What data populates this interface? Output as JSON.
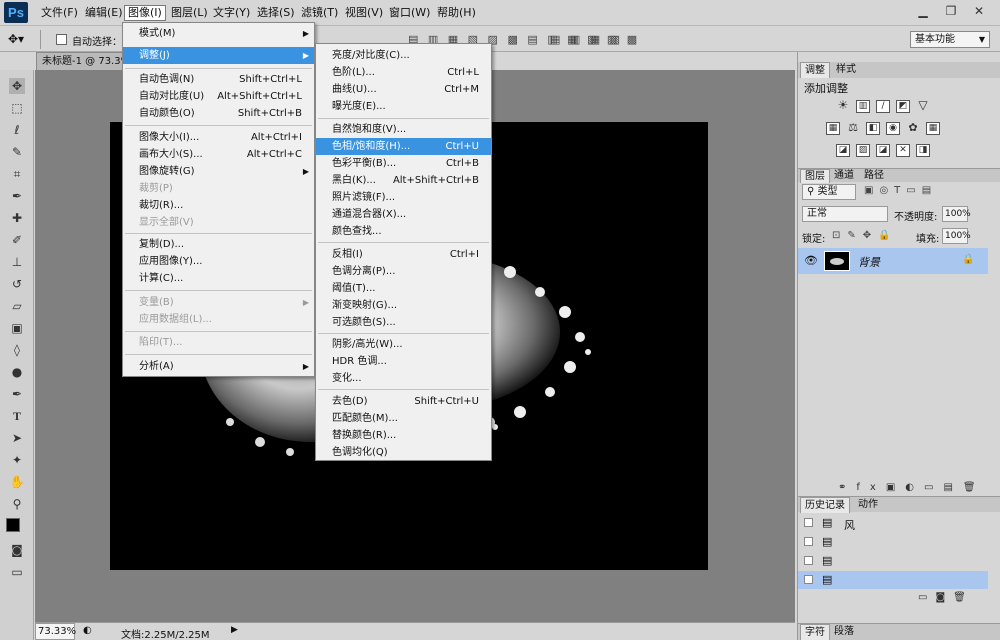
{
  "app": {
    "logo": "Ps"
  },
  "menubar": {
    "items": [
      "文件(F)",
      "编辑(E)",
      "图像(I)",
      "图层(L)",
      "文字(Y)",
      "选择(S)",
      "滤镜(T)",
      "视图(V)",
      "窗口(W)",
      "帮助(H)"
    ],
    "active": "图像(I)"
  },
  "window_controls": [
    "▁",
    "❐",
    "✕"
  ],
  "options": {
    "auto_select": "自动选择：",
    "workspace": "基本功能"
  },
  "document": {
    "tab_title": "未标题-1 @ 73.3%",
    "zoom": "73.33%",
    "doc_info": "文档:2.25M/2.25M"
  },
  "image_menu": {
    "items": [
      {
        "label": "模式(M)",
        "shortcut": "",
        "submenu": true
      },
      {
        "label": "调整(J)",
        "shortcut": "",
        "submenu": true,
        "highlighted": true
      },
      {
        "label": "自动色调(N)",
        "shortcut": "Shift+Ctrl+L"
      },
      {
        "label": "自动对比度(U)",
        "shortcut": "Alt+Shift+Ctrl+L"
      },
      {
        "label": "自动颜色(O)",
        "shortcut": "Shift+Ctrl+B"
      },
      {
        "label": "图像大小(I)...",
        "shortcut": "Alt+Ctrl+I"
      },
      {
        "label": "画布大小(S)...",
        "shortcut": "Alt+Ctrl+C"
      },
      {
        "label": "图像旋转(G)",
        "shortcut": "",
        "submenu": true
      },
      {
        "label": "裁剪(P)",
        "shortcut": "",
        "disabled": true
      },
      {
        "label": "裁切(R)...",
        "shortcut": ""
      },
      {
        "label": "显示全部(V)",
        "shortcut": "",
        "disabled": true
      },
      {
        "label": "复制(D)...",
        "shortcut": ""
      },
      {
        "label": "应用图像(Y)...",
        "shortcut": ""
      },
      {
        "label": "计算(C)...",
        "shortcut": ""
      },
      {
        "label": "变量(B)",
        "shortcut": "",
        "submenu": true,
        "disabled": true
      },
      {
        "label": "应用数据组(L)...",
        "shortcut": "",
        "disabled": true
      },
      {
        "label": "陷印(T)...",
        "shortcut": "",
        "disabled": true
      },
      {
        "label": "分析(A)",
        "shortcut": "",
        "submenu": true
      }
    ]
  },
  "adjust_menu": {
    "items": [
      {
        "label": "亮度/对比度(C)...",
        "shortcut": ""
      },
      {
        "label": "色阶(L)...",
        "shortcut": "Ctrl+L"
      },
      {
        "label": "曲线(U)...",
        "shortcut": "Ctrl+M"
      },
      {
        "label": "曝光度(E)...",
        "shortcut": ""
      },
      {
        "label": "自然饱和度(V)...",
        "shortcut": ""
      },
      {
        "label": "色相/饱和度(H)...",
        "shortcut": "Ctrl+U",
        "highlighted": true
      },
      {
        "label": "色彩平衡(B)...",
        "shortcut": "Ctrl+B"
      },
      {
        "label": "黑白(K)...",
        "shortcut": "Alt+Shift+Ctrl+B"
      },
      {
        "label": "照片滤镜(F)...",
        "shortcut": ""
      },
      {
        "label": "通道混合器(X)...",
        "shortcut": ""
      },
      {
        "label": "颜色查找...",
        "shortcut": ""
      },
      {
        "label": "反相(I)",
        "shortcut": "Ctrl+I"
      },
      {
        "label": "色调分离(P)...",
        "shortcut": ""
      },
      {
        "label": "阈值(T)...",
        "shortcut": ""
      },
      {
        "label": "渐变映射(G)...",
        "shortcut": ""
      },
      {
        "label": "可选颜色(S)...",
        "shortcut": ""
      },
      {
        "label": "阴影/高光(W)...",
        "shortcut": ""
      },
      {
        "label": "HDR 色调...",
        "shortcut": ""
      },
      {
        "label": "变化...",
        "shortcut": ""
      },
      {
        "label": "去色(D)",
        "shortcut": "Shift+Ctrl+U"
      },
      {
        "label": "匹配颜色(M)...",
        "shortcut": ""
      },
      {
        "label": "替换颜色(R)...",
        "shortcut": ""
      },
      {
        "label": "色调均化(Q)",
        "shortcut": ""
      }
    ]
  },
  "panels": {
    "adjust": {
      "tabs": [
        "调整",
        "样式"
      ],
      "title": "添加调整"
    },
    "layers": {
      "tabs": [
        "图层",
        "通道",
        "路径"
      ],
      "kind": "类型",
      "blend": "正常",
      "opacity_label": "不透明度:",
      "opacity": "100%",
      "lock_label": "锁定:",
      "fill_label": "填充:",
      "fill": "100%",
      "layer_name": "背景"
    },
    "history": {
      "tabs": [
        "历史记录",
        "动作"
      ],
      "items": [
        "风",
        "",
        "",
        ""
      ]
    },
    "bottom_tabs": [
      "字符",
      "段落"
    ]
  }
}
